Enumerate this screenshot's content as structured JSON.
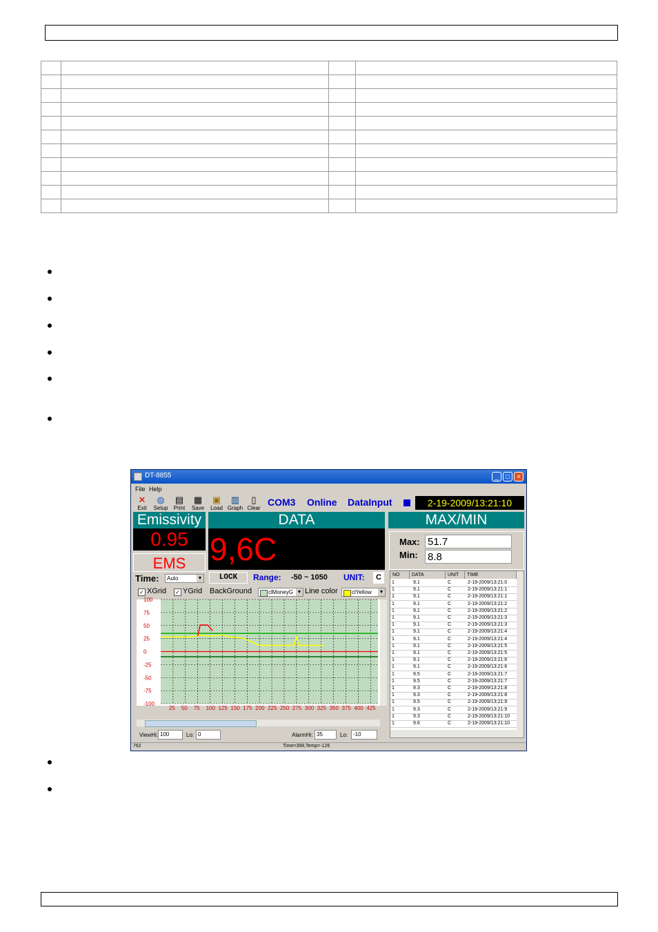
{
  "window": {
    "title": "DT-8855",
    "menus": [
      "File",
      "Help"
    ],
    "toolbar": [
      "Exit",
      "Setup",
      "Print",
      "Save",
      "Load",
      "Graph",
      "Clear"
    ],
    "status_port": "COM3",
    "status_online": "Online",
    "status_input": "DataInput",
    "datetime": "2-19-2009/13:21:10"
  },
  "panels": {
    "emissivity_title": "Emissivity",
    "emissivity_value": "0.95",
    "ems_label": "EMS",
    "data_title": "DATA",
    "data_value": "9,6C",
    "maxmin_title": "MAX/MIN",
    "max_label": "Max:",
    "max_value": "51.7",
    "min_label": "Min:",
    "min_value": "8.8"
  },
  "controls": {
    "time_label": "Time:",
    "time_value": "Auto",
    "lock_label": "LOCK",
    "range_label": "Range:",
    "range_value": "-50 ~ 1050",
    "unit_label": "UNIT:",
    "unit_value": "C",
    "xgrid_label": "XGrid",
    "ygrid_label": "YGrid",
    "background_label": "BackGround",
    "background_value": "clMoneyG",
    "linecolor_label": "Line color",
    "linecolor_value": "clYellow"
  },
  "chart_data": {
    "type": "line",
    "y_ticks": [
      "100",
      "75",
      "50",
      "25",
      "0",
      "-25",
      "-50",
      "-75",
      "-100"
    ],
    "x_ticks": [
      "25",
      "50",
      "75",
      "100",
      "125",
      "150",
      "175",
      "200",
      "225",
      "250",
      "275",
      "300",
      "325",
      "350",
      "375",
      "400",
      "425"
    ],
    "ylim": [
      -100,
      100
    ],
    "xlim": [
      0,
      440
    ],
    "xgrid": true,
    "ygrid": true,
    "alarm_hi": 35,
    "alarm_lo": -10,
    "series": [
      {
        "color": "#ffff00",
        "x": [
          0,
          60,
          75,
          80,
          95,
          110,
          125,
          140,
          165,
          200,
          240,
          270,
          275,
          280,
          330
        ],
        "y": [
          28,
          28,
          30,
          32,
          30,
          30,
          32,
          28,
          26,
          12,
          12,
          12,
          28,
          12,
          12
        ]
      },
      {
        "color": "#ff0000",
        "x": [
          75,
          80,
          90,
          95,
          105
        ],
        "y": [
          30,
          51,
          51,
          51,
          40
        ]
      }
    ]
  },
  "bottom": {
    "viewhi_label": "ViewHi:",
    "viewhi_value": "100",
    "viewlo_label": "Lo:",
    "viewlo_value": "0",
    "alarmhi_label": "AlarmHi:",
    "alarmhi_value": "35",
    "alarmlo_label": "Lo:",
    "alarmlo_value": "-10"
  },
  "list": {
    "headers": [
      "NO",
      "DATA",
      "UNIT",
      "TIME"
    ],
    "rows": [
      [
        "1",
        "9.1",
        "C",
        "2-19-2009/13:21:0"
      ],
      [
        "1",
        "9.1",
        "C",
        "2-19-2009/13:21:1"
      ],
      [
        "1",
        "9.1",
        "C",
        "2-19-2009/13:21:1"
      ],
      [
        "1",
        "9.1",
        "C",
        "2-19-2009/13:21:2"
      ],
      [
        "1",
        "9.1",
        "C",
        "2-19-2009/13:21:2"
      ],
      [
        "1",
        "9.1",
        "C",
        "2-19-2009/13:21:3"
      ],
      [
        "1",
        "9.1",
        "C",
        "2-19-2009/13:21:3"
      ],
      [
        "1",
        "9.1",
        "C",
        "2-19-2009/13:21:4"
      ],
      [
        "1",
        "9.1",
        "C",
        "2-19-2009/13:21:4"
      ],
      [
        "1",
        "9.1",
        "C",
        "2-19-2009/13:21:5"
      ],
      [
        "1",
        "9.1",
        "C",
        "2-19-2009/13:21:5"
      ],
      [
        "1",
        "9.1",
        "C",
        "2-19-2009/13:21:6"
      ],
      [
        "1",
        "9.1",
        "C",
        "2-19-2009/13:21:6"
      ],
      [
        "1",
        "9.5",
        "C",
        "2-19-2009/13:21:7"
      ],
      [
        "1",
        "9.5",
        "C",
        "2-19-2009/13:21:7"
      ],
      [
        "1",
        "9.3",
        "C",
        "2-19-2009/13:21:8"
      ],
      [
        "1",
        "9.3",
        "C",
        "2-19-2009/13:21:8"
      ],
      [
        "1",
        "9.5",
        "C",
        "2-19-2009/13:21:9"
      ],
      [
        "1",
        "9.3",
        "C",
        "2-19-2009/13:21:9"
      ],
      [
        "1",
        "9.3",
        "C",
        "2-19-2009/13:21:10"
      ],
      [
        "1",
        "9.6",
        "C",
        "2-19-2009/13:21:10"
      ]
    ]
  },
  "statusbar": {
    "left": "762",
    "center": "Time=399,Temp=-126"
  },
  "colors": {
    "teal": "#008080",
    "plot_bg": "#c0dcc0",
    "alarm_line": "#00aa00",
    "zero_line": "#ff0000"
  }
}
